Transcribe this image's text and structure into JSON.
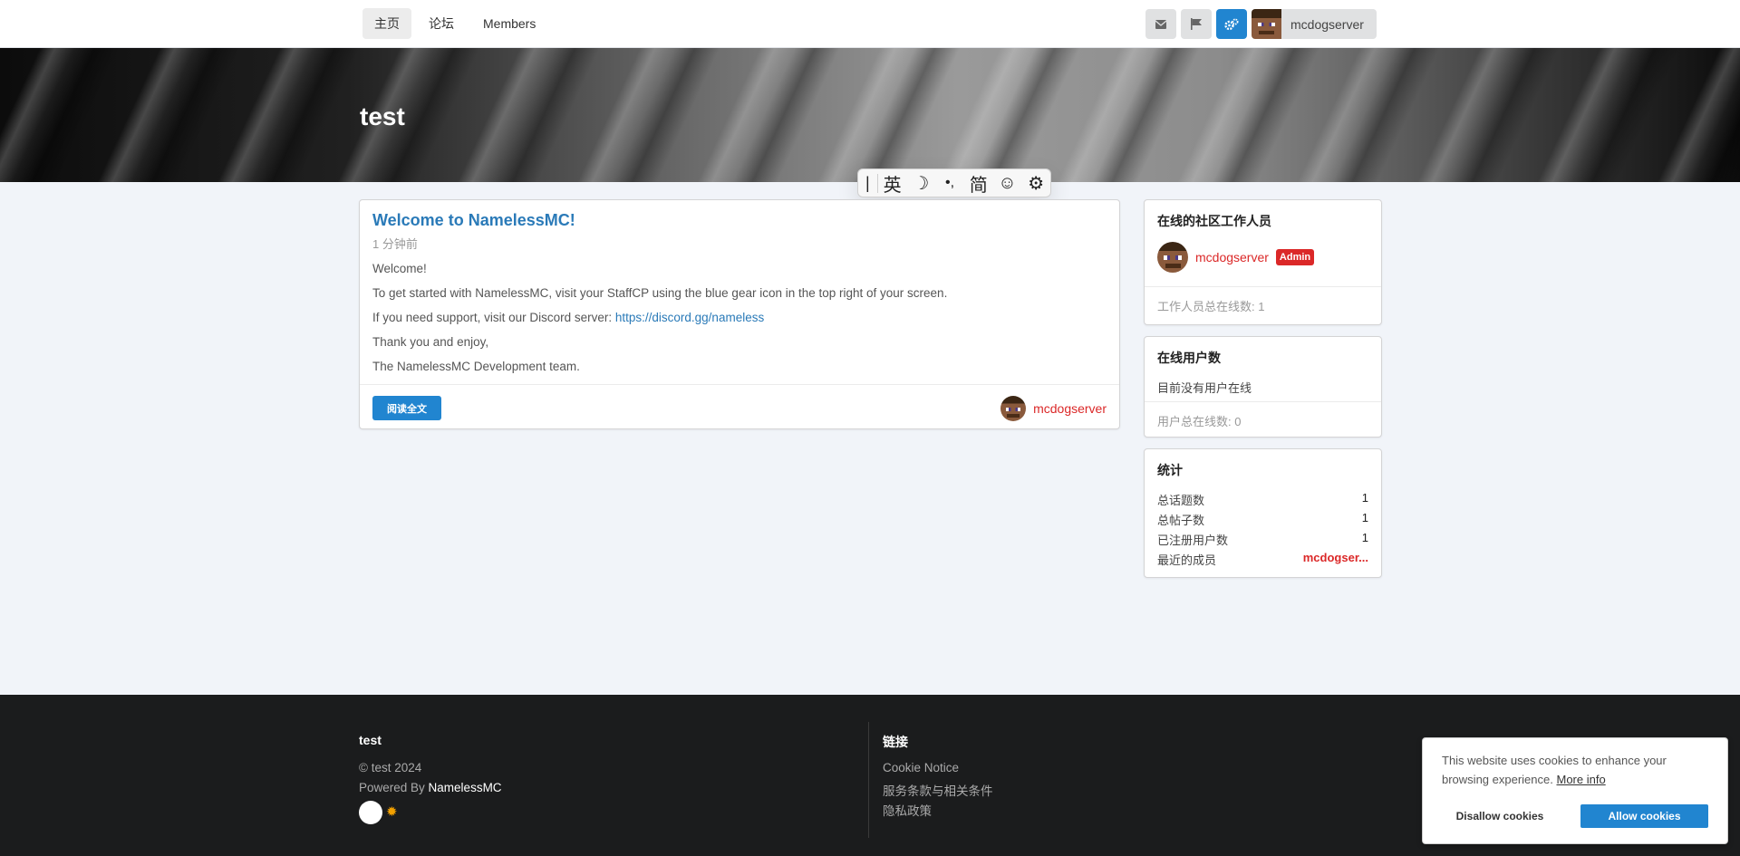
{
  "nav": {
    "items": [
      {
        "label": "主页",
        "active": true
      },
      {
        "label": "论坛",
        "active": false
      },
      {
        "label": "Members",
        "active": false
      }
    ],
    "icons": [
      "envelope-icon",
      "flag-icon",
      "gears-icon"
    ],
    "username": "mcdogserver"
  },
  "banner": {
    "title": "test"
  },
  "ime": {
    "buttons": [
      "英",
      "☽",
      "•,",
      "简",
      "☺",
      "⚙"
    ]
  },
  "news": {
    "title": "Welcome to NamelessMC!",
    "time": "1 分钟前",
    "lines": [
      "Welcome!",
      "To get started with NamelessMC, visit your StaffCP using the blue gear icon in the top right of your screen.",
      "If you need support, visit our Discord server: ",
      "Thank you and enjoy,",
      "The NamelessMC Development team."
    ],
    "link": "https://discord.gg/nameless",
    "read_more": "阅读全文",
    "author": "mcdogserver"
  },
  "staff_online": {
    "title": "在线的社区工作人员",
    "user": "mcdogserver",
    "badge": "Admin",
    "total": "工作人员总在线数: 1"
  },
  "users_online": {
    "title": "在线用户数",
    "none": "目前没有用户在线",
    "total": "用户总在线数: 0"
  },
  "stats": {
    "title": "统计",
    "rows": [
      {
        "label": "总话题数",
        "value": "1"
      },
      {
        "label": "总帖子数",
        "value": "1"
      },
      {
        "label": "已注册用户数",
        "value": "1"
      },
      {
        "label": "最近的成员",
        "value": "mcdogser..."
      }
    ]
  },
  "footer": {
    "site": "test",
    "copyright": "© test 2024",
    "powered_prefix": "Powered By ",
    "powered_name": "NamelessMC",
    "links_title": "链接",
    "links": [
      "Cookie Notice",
      "服务条款与相关条件",
      "隐私政策"
    ]
  },
  "cookie": {
    "message": "This website uses cookies to enhance your browsing experience.",
    "more_info": "More info",
    "disallow": "Disallow cookies",
    "allow": "Allow cookies"
  }
}
